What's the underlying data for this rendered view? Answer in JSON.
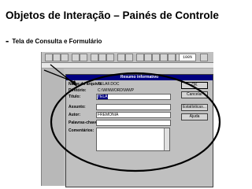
{
  "title": "Objetos de Interação – Painés de Controle",
  "subtitle_dash": "-",
  "subtitle": "Tela de Consulta e Formulário",
  "toolbar": {
    "zoom": "100%"
  },
  "dialog": {
    "title": "Resumo informativo",
    "fields": {
      "file_name_label": "Nome do arquivo:",
      "file_name_value": "TELAF.DOC",
      "directory_label": "Diretório:",
      "directory_value": "C:\\WINWORD\\WWP",
      "title_label": "Título:",
      "title_value": "TELA",
      "subject_label": "Assunto:",
      "subject_value": "",
      "author_label": "Autor:",
      "author_value": "FREMONIA",
      "keywords_label": "Palavras-chave:",
      "keywords_value": "",
      "comments_label": "Comentários:",
      "comments_value": ""
    },
    "buttons": {
      "ok": "OK",
      "cancel": "Cancelar",
      "statistics": "Estatísticas...",
      "help": "Ajuda"
    }
  },
  "colors": {
    "titlebar": "#000080",
    "annotation": "#000000"
  }
}
